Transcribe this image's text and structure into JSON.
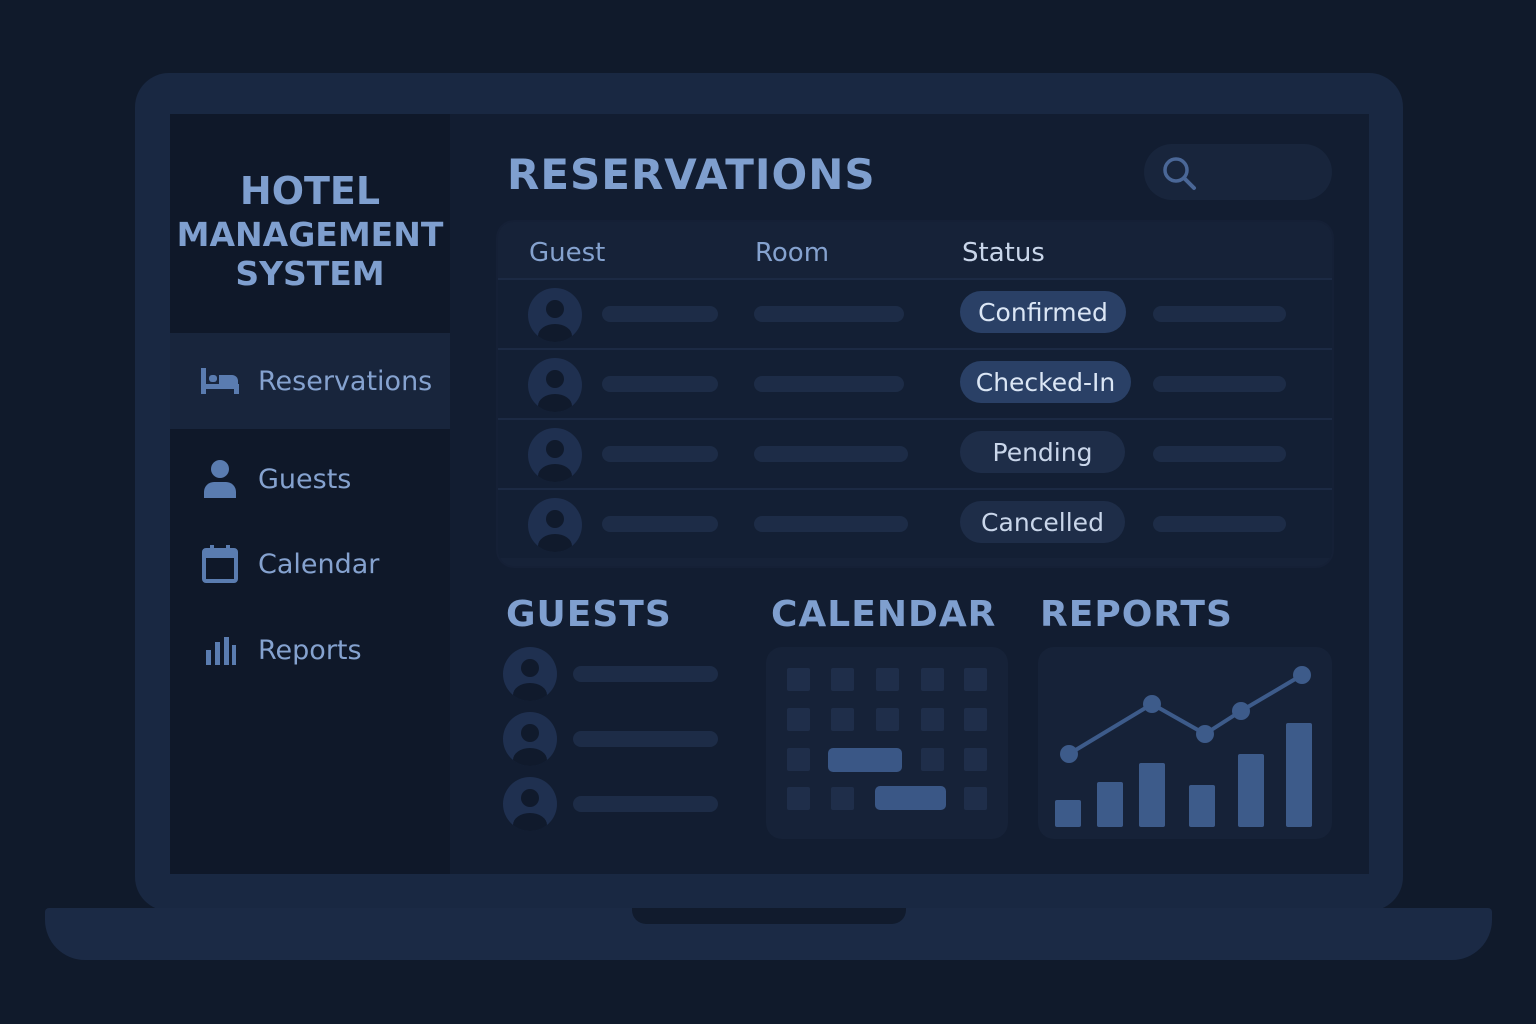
{
  "app": {
    "title_lines": [
      "HOTEL",
      "MANAGEMENT",
      "SYSTEM"
    ]
  },
  "sidebar": {
    "items": [
      {
        "label": "Reservations",
        "icon": "bed-icon",
        "active": true
      },
      {
        "label": "Guests",
        "icon": "person-icon",
        "active": false
      },
      {
        "label": "Calendar",
        "icon": "calendar-icon",
        "active": false
      },
      {
        "label": "Reports",
        "icon": "bar-chart-icon",
        "active": false
      }
    ]
  },
  "main": {
    "title": "RESERVATIONS",
    "search": {
      "icon": "search-icon"
    },
    "table": {
      "columns": [
        "Guest",
        "Room",
        "Status"
      ],
      "rows": [
        {
          "status": "Confirmed"
        },
        {
          "status": "Checked-In"
        },
        {
          "status": "Pending"
        },
        {
          "status": "Cancelled"
        }
      ]
    },
    "sections": {
      "guests": "GUESTS",
      "calendar": "CALENDAR",
      "reports": "REPORTS"
    }
  },
  "colors": {
    "accent": "#7f9fcf",
    "status_active": "#2a4066",
    "status_muted": "#1e2d48",
    "chart": "#3d5b8a"
  }
}
